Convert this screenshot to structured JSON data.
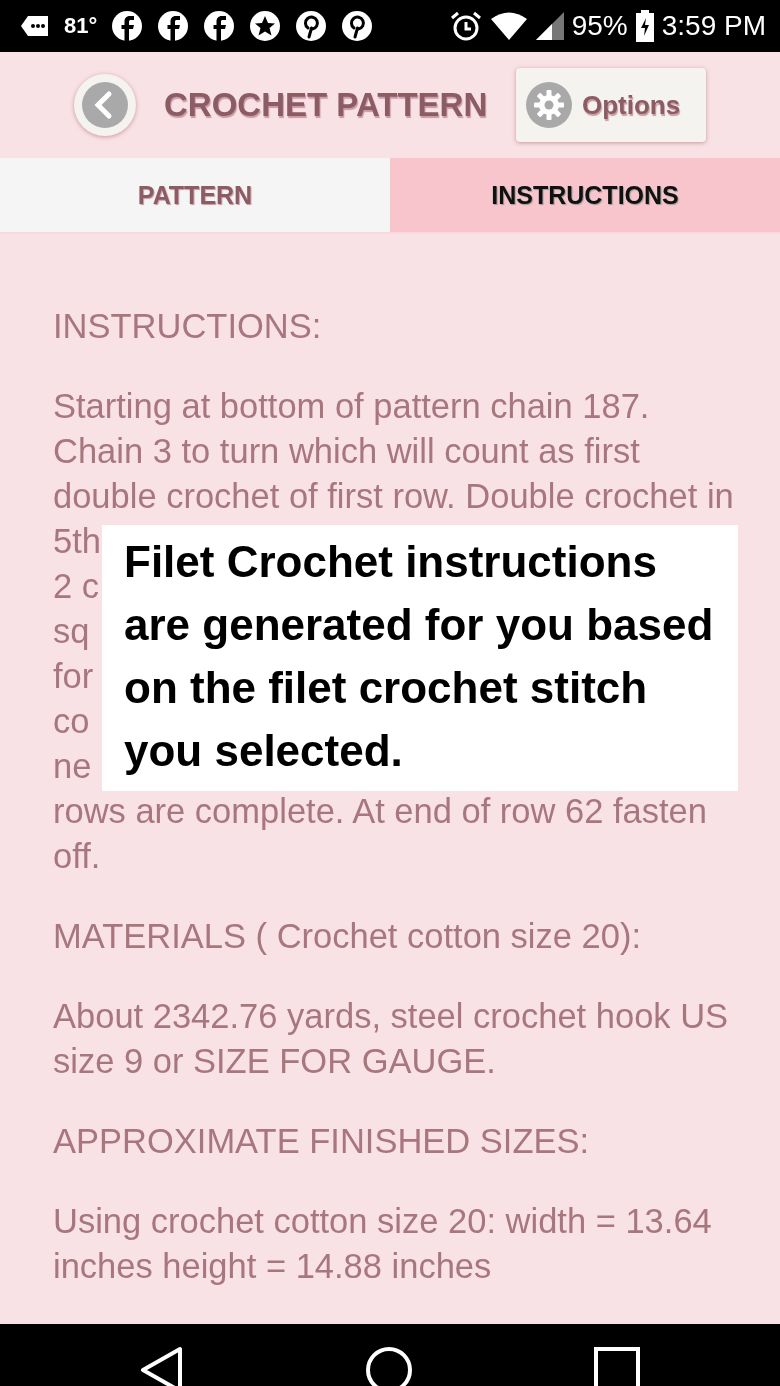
{
  "status_bar": {
    "temperature": "81°",
    "battery": "95%",
    "time": "3:59 PM"
  },
  "header": {
    "title": "CROCHET PATTERN",
    "options_button": "Options"
  },
  "tabs": [
    {
      "label": "PATTERN",
      "selected": false
    },
    {
      "label": "INSTRUCTIONS",
      "selected": true
    }
  ],
  "content": {
    "heading": "INSTRUCTIONS:",
    "lines_before": [
      "Starting at bottom of pattern chain 187.",
      "Chain 3 to turn which will count as first",
      "double crochet of first row. Double crochet in"
    ],
    "covered_fragments": [
      "5th",
      "2 c",
      "sq",
      "for",
      "co",
      "ne"
    ],
    "lines_after": [
      "rows are complete. At end of row 62 fasten",
      "off."
    ],
    "sections": [
      {
        "heading": "MATERIALS ( Crochet cotton size 20):",
        "lines": [
          "About 2342.76 yards, steel crochet hook US",
          "size 9 or SIZE FOR GAUGE."
        ]
      },
      {
        "heading": "APPROXIMATE FINISHED SIZES:",
        "lines": [
          "Using crochet cotton size 20: width = 13.64",
          "inches height = 14.88 inches"
        ]
      }
    ]
  },
  "callout": {
    "lines": [
      "Filet Crochet instructions",
      "are generated for you based",
      "on the filet crochet stitch",
      "you selected."
    ]
  }
}
